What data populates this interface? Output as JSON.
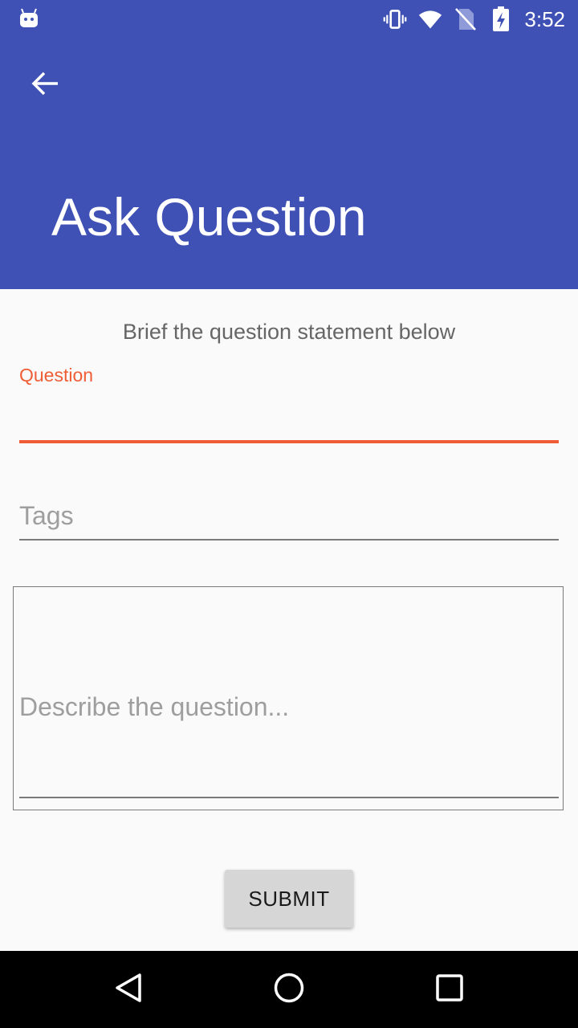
{
  "status_bar": {
    "time": "3:52",
    "icons": [
      "android-icon",
      "vibrate-icon",
      "wifi-icon",
      "no-sim-icon",
      "battery-charging-icon"
    ]
  },
  "app_bar": {
    "title": "Ask Question",
    "back_icon": "arrow-back-icon",
    "background_color": "#3f51b5"
  },
  "form": {
    "subtitle": "Brief the question statement below",
    "question": {
      "label": "Question",
      "value": "",
      "accent_color": "#ef5d36"
    },
    "tags": {
      "placeholder": "Tags",
      "value": ""
    },
    "description": {
      "placeholder": "Describe the question...",
      "value": ""
    },
    "submit_label": "SUBMIT"
  },
  "nav_bar": {
    "buttons": [
      "back-triangle-icon",
      "home-circle-icon",
      "recents-square-icon"
    ]
  }
}
